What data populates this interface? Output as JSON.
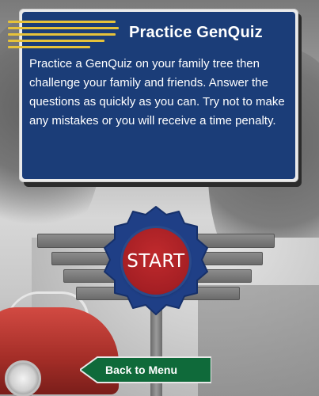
{
  "panel": {
    "title": "Practice GenQuiz",
    "description": "Practice a GenQuiz on your family tree then challenge your family and friends. Answer the questions as quickly as you can. Try not to make any mistakes or you will receive a time penalty."
  },
  "start_button": {
    "label": "START"
  },
  "back_button": {
    "label": "Back to Menu"
  },
  "colors": {
    "panel_blue": "#1b3d78",
    "accent_stripes": "#e6c23a",
    "start_red": "#a51f24",
    "back_green": "#0f6a3a"
  }
}
